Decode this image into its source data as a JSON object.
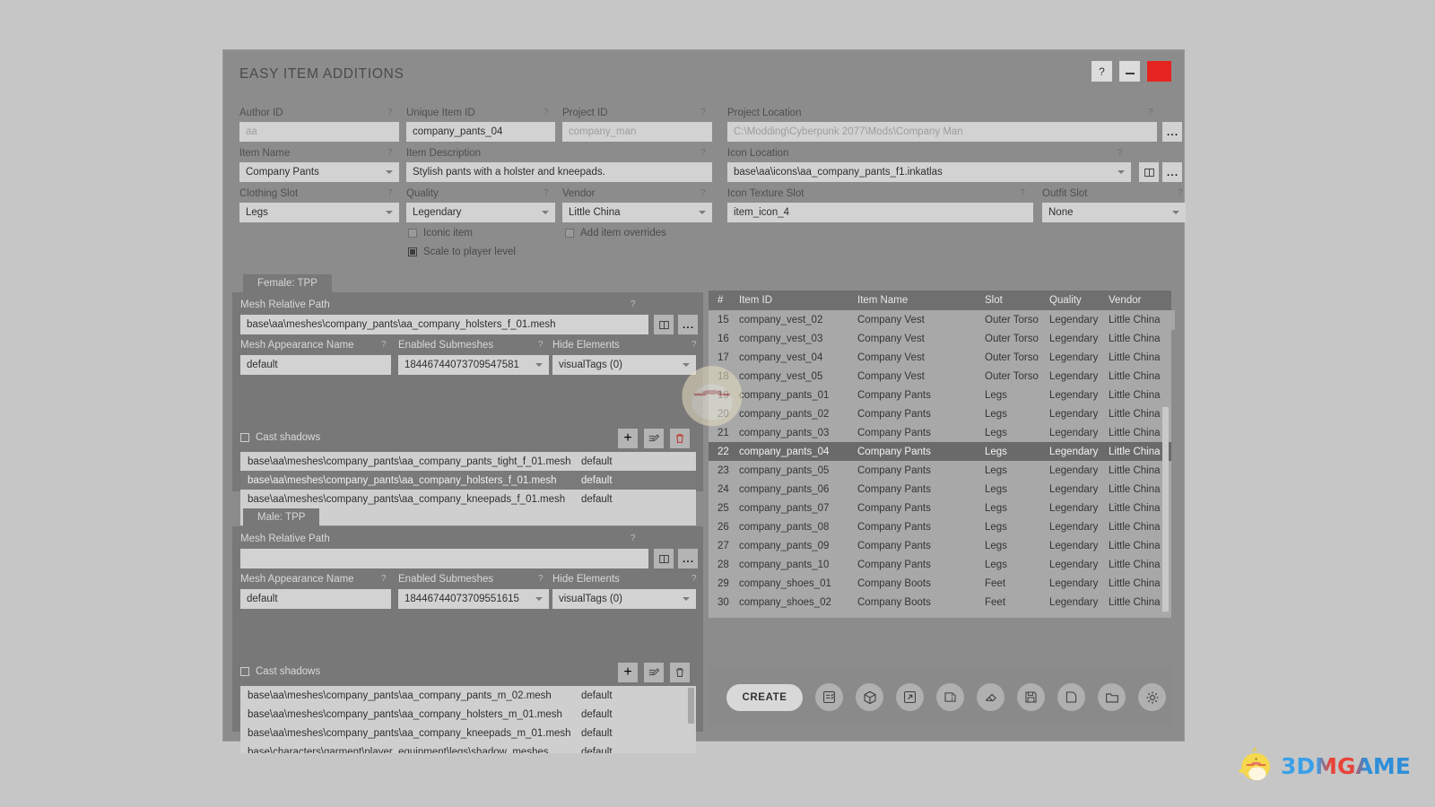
{
  "window": {
    "title": "EASY ITEM ADDITIONS",
    "help_label": "?",
    "minimize_label": "",
    "close_label": ""
  },
  "form": {
    "author_id": {
      "label": "Author ID",
      "value": "aa",
      "placeholder": "aa",
      "hint": "?",
      "is_placeholder": true
    },
    "unique_item_id": {
      "label": "Unique Item ID",
      "value": "company_pants_04",
      "hint": "?"
    },
    "project_id": {
      "label": "Project ID",
      "value": "company_man",
      "placeholder": "company_man",
      "hint": "?",
      "is_placeholder": true
    },
    "project_location": {
      "label": "Project Location",
      "value": "C:\\Modding\\Cyberpunk 2077\\Mods\\Company Man",
      "hint": "?",
      "is_placeholder": true,
      "browse_label": "..."
    },
    "item_name": {
      "label": "Item Name",
      "value": "Company Pants",
      "hint": "?"
    },
    "item_description": {
      "label": "Item Description",
      "value": "Stylish pants with a holster and kneepads.",
      "hint": "?"
    },
    "icon_location": {
      "label": "Icon Location",
      "value": "base\\aa\\icons\\aa_company_pants_f1.inkatlas",
      "hint": "?",
      "browse_label": "..."
    },
    "clothing_slot": {
      "label": "Clothing Slot",
      "value": "Legs",
      "hint": "?"
    },
    "quality": {
      "label": "Quality",
      "value": "Legendary",
      "hint": "?"
    },
    "vendor": {
      "label": "Vendor",
      "value": "Little China",
      "hint": "?"
    },
    "icon_texture_slot": {
      "label": "Icon Texture Slot",
      "value": "item_icon_4",
      "hint": "?"
    },
    "outfit_slot": {
      "label": "Outfit Slot",
      "value": "None",
      "hint": "?"
    },
    "iconic_item": {
      "label": "Iconic item",
      "checked": false
    },
    "add_item_overrides": {
      "label": "Add item overrides",
      "checked": false
    },
    "scale_to_player_level": {
      "label": "Scale to player level",
      "checked": true
    }
  },
  "list_toolbar": {
    "edit_label": "edit-icon",
    "move_up_label": "chevron-up-icon",
    "move_down_label": "chevron-down-icon",
    "delete_label": "trash-icon"
  },
  "female_panel": {
    "tab_label": "Female: TPP",
    "mesh_relative_path": {
      "label": "Mesh Relative Path",
      "value": "base\\aa\\meshes\\company_pants\\aa_company_holsters_f_01.mesh",
      "hint": "?",
      "browse_label": "..."
    },
    "mesh_appearance_name": {
      "label": "Mesh Appearance Name",
      "value": "default",
      "hint": "?"
    },
    "enabled_submeshes": {
      "label": "Enabled Submeshes",
      "value": "18446744073709547581",
      "hint": "?"
    },
    "hide_elements": {
      "label": "Hide Elements",
      "value": "visualTags (0)",
      "hint": "?"
    },
    "cast_shadows": {
      "label": "Cast shadows",
      "checked": false
    },
    "rows": [
      {
        "path": "base\\aa\\meshes\\company_pants\\aa_company_pants_tight_f_01.mesh",
        "appearance": "default",
        "selected": false
      },
      {
        "path": "base\\aa\\meshes\\company_pants\\aa_company_holsters_f_01.mesh",
        "appearance": "default",
        "selected": true
      },
      {
        "path": "base\\aa\\meshes\\company_pants\\aa_company_kneepads_f_01.mesh",
        "appearance": "default",
        "selected": false
      }
    ]
  },
  "male_panel": {
    "tab_label": "Male: TPP",
    "mesh_relative_path": {
      "label": "Mesh Relative Path",
      "value": "",
      "hint": "?",
      "browse_label": "..."
    },
    "mesh_appearance_name": {
      "label": "Mesh Appearance Name",
      "value": "default",
      "hint": "?"
    },
    "enabled_submeshes": {
      "label": "Enabled Submeshes",
      "value": "18446744073709551615",
      "hint": "?"
    },
    "hide_elements": {
      "label": "Hide Elements",
      "value": "visualTags (0)",
      "hint": "?"
    },
    "cast_shadows": {
      "label": "Cast shadows",
      "checked": false
    },
    "rows": [
      {
        "path": "base\\aa\\meshes\\company_pants\\aa_company_pants_m_02.mesh",
        "appearance": "default",
        "selected": false
      },
      {
        "path": "base\\aa\\meshes\\company_pants\\aa_company_holsters_m_01.mesh",
        "appearance": "default",
        "selected": false
      },
      {
        "path": "base\\aa\\meshes\\company_pants\\aa_company_kneepads_m_01.mesh",
        "appearance": "default",
        "selected": false
      },
      {
        "path": "base\\characters\\garment\\player_equipment\\legs\\shadow_meshes",
        "appearance": "default",
        "selected": false
      }
    ]
  },
  "item_table": {
    "headers": [
      "#",
      "Item ID",
      "Item Name",
      "Slot",
      "Quality",
      "Vendor"
    ],
    "rows": [
      {
        "num": "15",
        "id": "company_vest_02",
        "name": "Company Vest",
        "slot": "Outer Torso",
        "quality": "Legendary",
        "vendor": "Little China",
        "selected": false
      },
      {
        "num": "16",
        "id": "company_vest_03",
        "name": "Company Vest",
        "slot": "Outer Torso",
        "quality": "Legendary",
        "vendor": "Little China",
        "selected": false
      },
      {
        "num": "17",
        "id": "company_vest_04",
        "name": "Company Vest",
        "slot": "Outer Torso",
        "quality": "Legendary",
        "vendor": "Little China",
        "selected": false
      },
      {
        "num": "18",
        "id": "company_vest_05",
        "name": "Company Vest",
        "slot": "Outer Torso",
        "quality": "Legendary",
        "vendor": "Little China",
        "selected": false
      },
      {
        "num": "19",
        "id": "company_pants_01",
        "name": "Company Pants",
        "slot": "Legs",
        "quality": "Legendary",
        "vendor": "Little China",
        "selected": false
      },
      {
        "num": "20",
        "id": "company_pants_02",
        "name": "Company Pants",
        "slot": "Legs",
        "quality": "Legendary",
        "vendor": "Little China",
        "selected": false
      },
      {
        "num": "21",
        "id": "company_pants_03",
        "name": "Company Pants",
        "slot": "Legs",
        "quality": "Legendary",
        "vendor": "Little China",
        "selected": false
      },
      {
        "num": "22",
        "id": "company_pants_04",
        "name": "Company Pants",
        "slot": "Legs",
        "quality": "Legendary",
        "vendor": "Little China",
        "selected": true
      },
      {
        "num": "23",
        "id": "company_pants_05",
        "name": "Company Pants",
        "slot": "Legs",
        "quality": "Legendary",
        "vendor": "Little China",
        "selected": false
      },
      {
        "num": "24",
        "id": "company_pants_06",
        "name": "Company Pants",
        "slot": "Legs",
        "quality": "Legendary",
        "vendor": "Little China",
        "selected": false
      },
      {
        "num": "25",
        "id": "company_pants_07",
        "name": "Company Pants",
        "slot": "Legs",
        "quality": "Legendary",
        "vendor": "Little China",
        "selected": false
      },
      {
        "num": "26",
        "id": "company_pants_08",
        "name": "Company Pants",
        "slot": "Legs",
        "quality": "Legendary",
        "vendor": "Little China",
        "selected": false
      },
      {
        "num": "27",
        "id": "company_pants_09",
        "name": "Company Pants",
        "slot": "Legs",
        "quality": "Legendary",
        "vendor": "Little China",
        "selected": false
      },
      {
        "num": "28",
        "id": "company_pants_10",
        "name": "Company Pants",
        "slot": "Legs",
        "quality": "Legendary",
        "vendor": "Little China",
        "selected": false
      },
      {
        "num": "29",
        "id": "company_shoes_01",
        "name": "Company Boots",
        "slot": "Feet",
        "quality": "Legendary",
        "vendor": "Little China",
        "selected": false
      },
      {
        "num": "30",
        "id": "company_shoes_02",
        "name": "Company Boots",
        "slot": "Feet",
        "quality": "Legendary",
        "vendor": "Little China",
        "selected": false
      }
    ]
  },
  "bottom_bar": {
    "create_label": "CREATE",
    "actions": [
      "checklist-icon",
      "package-icon",
      "export-icon",
      "archive-icon",
      "eraser-icon",
      "save-icon",
      "new-file-icon",
      "open-folder-icon",
      "settings-gear-icon"
    ]
  },
  "mesh_actions": {
    "add_label": "+",
    "edit_label": "edit-icon",
    "delete_label": "trash-icon"
  },
  "watermark": {
    "text": "3DMGAME"
  },
  "colors": {
    "window_bg": "#8c8c8c",
    "panel_bg": "#787878",
    "input_bg": "#d2d2d2",
    "list_bg": "#cfcfcf",
    "selection": "#6a6a6a",
    "close_red": "#e52421",
    "page_bg": "#c6c6c6"
  }
}
